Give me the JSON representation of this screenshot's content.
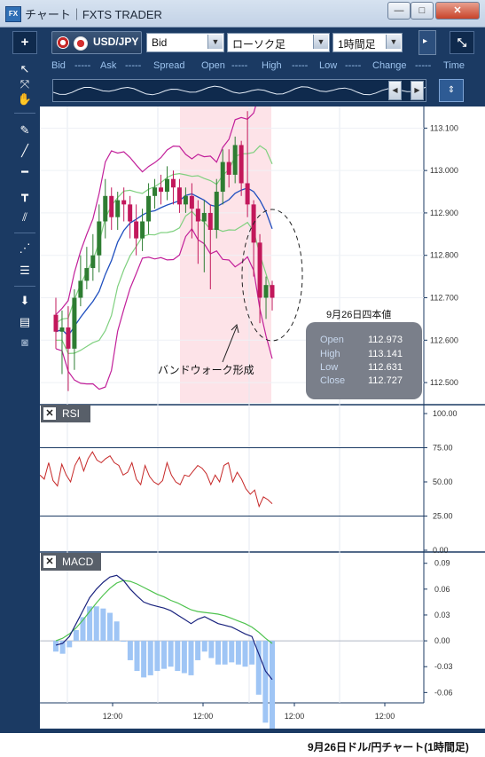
{
  "window": {
    "title": "チャート｜FXTS TRADER",
    "buttons": [
      "—",
      "□",
      "✕"
    ]
  },
  "toolbar": {
    "add_label": "+",
    "symbol": "USD/JPY",
    "price_side": "Bid",
    "chart_type": "ローソク足",
    "timeframe": "1時間足",
    "detach_label": "⤡"
  },
  "quote_bar": {
    "items": [
      "Bid",
      "Ask",
      "Spread",
      "Open",
      "High",
      "Low",
      "Change",
      "Time"
    ],
    "placeholder": "-----"
  },
  "tools": [
    "pointer-icon",
    "crosshair-icon",
    "hand-icon",
    "pin-icon",
    "trendline-icon",
    "horizontal-line-icon",
    "vertical-line-icon",
    "channel-icon",
    "fibonacci-fan-icon",
    "fibonacci-retracement-icon",
    "download-icon",
    "list-icon",
    "camera-icon"
  ],
  "colors": {
    "window_bg": "#1b3a63",
    "candle_up": "#2e7d32",
    "candle_down": "#c2185b",
    "bb_outer": "#c2209a",
    "bb_mid": "#7fd07f",
    "ma": "#1f4fbf",
    "highlight": "#fde3e8",
    "rsi": "#c62828",
    "macd": "#1a237e",
    "signal": "#4fc34f",
    "histogram": "#9fc5f5"
  },
  "price_axis": [
    "113.100",
    "113.000",
    "112.900",
    "112.800",
    "112.700",
    "112.600",
    "112.500"
  ],
  "rsi": {
    "label": "RSI",
    "axis": [
      "100.00",
      "75.00",
      "50.00",
      "25.00",
      "0.00"
    ]
  },
  "macd": {
    "label": "MACD",
    "axis": [
      "0.09",
      "0.06",
      "0.03",
      "0.00",
      "-0.03",
      "-0.06"
    ]
  },
  "time_axis": [
    "12:00",
    "12:00",
    "12:00",
    "12:00"
  ],
  "annotations": {
    "band_walk": "バンドウォーク形成",
    "ohlc_title": "9月26日四本値"
  },
  "ohlc": [
    {
      "label": "Open",
      "value": "112.973"
    },
    {
      "label": "High",
      "value": "113.141"
    },
    {
      "label": "Low",
      "value": "112.631"
    },
    {
      "label": "Close",
      "value": "112.727"
    }
  ],
  "caption": "9月26日ドル/円チャート(1時間足)",
  "chart_data": {
    "type": "candlestick",
    "price_ylim": [
      112.45,
      113.13
    ],
    "candles": [
      [
        112.66,
        112.62,
        112.7,
        112.58
      ],
      [
        112.62,
        112.63,
        112.67,
        112.52
      ],
      [
        112.63,
        112.58,
        112.68,
        112.48
      ],
      [
        112.58,
        112.7,
        112.72,
        112.53
      ],
      [
        112.7,
        112.74,
        112.8,
        112.68
      ],
      [
        112.74,
        112.77,
        112.82,
        112.72
      ],
      [
        112.77,
        112.8,
        112.85,
        112.74
      ],
      [
        112.8,
        112.88,
        112.92,
        112.76
      ],
      [
        112.88,
        112.94,
        112.98,
        112.84
      ],
      [
        112.94,
        112.89,
        112.96,
        112.86
      ],
      [
        112.89,
        112.93,
        112.95,
        112.86
      ],
      [
        112.93,
        112.92,
        112.96,
        112.88
      ],
      [
        112.92,
        112.88,
        112.94,
        112.84
      ],
      [
        112.88,
        112.84,
        112.92,
        112.8
      ],
      [
        112.84,
        112.88,
        112.91,
        112.81
      ],
      [
        112.88,
        112.94,
        112.97,
        112.85
      ],
      [
        112.94,
        112.96,
        112.98,
        112.91
      ],
      [
        112.96,
        112.95,
        112.99,
        112.92
      ],
      [
        112.95,
        112.98,
        113.01,
        112.93
      ],
      [
        112.98,
        112.96,
        113.0,
        112.92
      ],
      [
        112.96,
        112.92,
        112.98,
        112.9
      ],
      [
        112.92,
        112.94,
        112.96,
        112.9
      ],
      [
        112.94,
        112.91,
        112.97,
        112.84
      ],
      [
        112.91,
        112.88,
        112.93,
        112.78
      ],
      [
        112.88,
        112.9,
        112.93,
        112.76
      ],
      [
        112.9,
        112.86,
        112.92,
        112.72
      ],
      [
        112.86,
        112.95,
        112.98,
        112.84
      ],
      [
        112.95,
        113.02,
        113.05,
        112.92
      ],
      [
        113.02,
        112.99,
        113.05,
        112.96
      ],
      [
        112.99,
        113.06,
        113.08,
        112.97
      ],
      [
        113.06,
        112.97,
        113.07,
        112.94
      ],
      [
        112.97,
        112.92,
        113.14,
        112.89
      ],
      [
        112.92,
        112.83,
        112.93,
        112.75
      ],
      [
        112.83,
        112.7,
        112.85,
        112.64
      ],
      [
        112.7,
        112.73,
        112.75,
        112.65
      ],
      [
        112.73,
        112.7,
        112.74,
        112.67
      ]
    ],
    "rsi": [
      55,
      52,
      64,
      51,
      47,
      63,
      55,
      50,
      62,
      68,
      58,
      67,
      72,
      66,
      64,
      67,
      69,
      64,
      62,
      55,
      57,
      64,
      52,
      48,
      62,
      54,
      50,
      48,
      51,
      64,
      55,
      50,
      48,
      55,
      54,
      58,
      62,
      60,
      56,
      48,
      55,
      50,
      62,
      64,
      50,
      57,
      52,
      45,
      41,
      44,
      32,
      39,
      37,
      34
    ],
    "macd": [
      -0.005,
      -0.003,
      0.005,
      0.02,
      0.035,
      0.05,
      0.06,
      0.068,
      0.074,
      0.076,
      0.07,
      0.06,
      0.052,
      0.045,
      0.042,
      0.04,
      0.038,
      0.035,
      0.03,
      0.025,
      0.02,
      0.025,
      0.028,
      0.024,
      0.02,
      0.018,
      0.016,
      0.012,
      0.008,
      0.005,
      -0.015,
      -0.035,
      -0.045
    ],
    "signal": [
      0.0,
      0.003,
      0.008,
      0.015,
      0.024,
      0.034,
      0.044,
      0.053,
      0.061,
      0.067,
      0.07,
      0.069,
      0.066,
      0.062,
      0.058,
      0.054,
      0.051,
      0.047,
      0.044,
      0.04,
      0.036,
      0.034,
      0.033,
      0.032,
      0.031,
      0.029,
      0.026,
      0.023,
      0.02,
      0.016,
      0.01,
      0.003,
      -0.003
    ]
  }
}
